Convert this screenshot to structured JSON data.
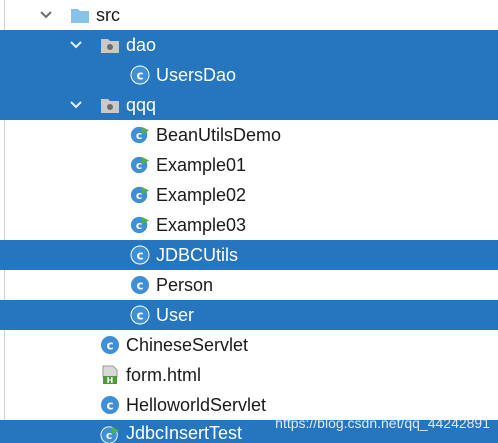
{
  "tree": {
    "rows": [
      {
        "label": "src",
        "icon": "source-folder-icon",
        "chevron": "expanded",
        "selected": false
      },
      {
        "label": "dao",
        "icon": "package-icon",
        "chevron": "expanded",
        "selected": true
      },
      {
        "label": "UsersDao",
        "icon": "java-class-icon",
        "chevron": "none",
        "selected": true
      },
      {
        "label": "qqq",
        "icon": "package-icon",
        "chevron": "expanded",
        "selected": true
      },
      {
        "label": "BeanUtilsDemo",
        "icon": "runnable-class-icon",
        "chevron": "none",
        "selected": false
      },
      {
        "label": "Example01",
        "icon": "runnable-class-icon",
        "chevron": "none",
        "selected": false
      },
      {
        "label": "Example02",
        "icon": "runnable-class-icon",
        "chevron": "none",
        "selected": false
      },
      {
        "label": "Example03",
        "icon": "runnable-class-icon",
        "chevron": "none",
        "selected": false
      },
      {
        "label": "JDBCUtils",
        "icon": "java-class-icon",
        "chevron": "none",
        "selected": true
      },
      {
        "label": "Person",
        "icon": "java-class-icon",
        "chevron": "none",
        "selected": false
      },
      {
        "label": "User",
        "icon": "java-class-icon",
        "chevron": "none",
        "selected": true
      },
      {
        "label": "ChineseServlet",
        "icon": "java-class-icon",
        "chevron": "none",
        "selected": false
      },
      {
        "label": "form.html",
        "icon": "html-file-icon",
        "chevron": "none",
        "selected": false
      },
      {
        "label": "HelloworldServlet",
        "icon": "java-class-icon",
        "chevron": "none",
        "selected": false
      },
      {
        "label": "JdbcInsertTest",
        "icon": "runnable-class-icon",
        "chevron": "none",
        "selected": true
      }
    ]
  },
  "watermark": "https://blog.csdn.net/qq_44242891",
  "colors": {
    "selection": "#2675bf",
    "folder": "#87c3e8",
    "class_icon": "#3f8fd6",
    "run_arrow": "#4caf50"
  }
}
